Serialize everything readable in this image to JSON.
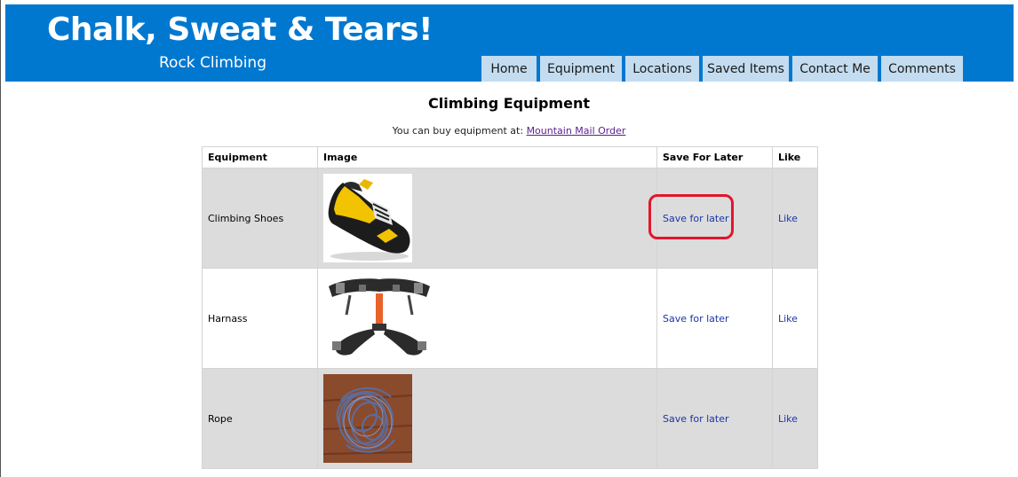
{
  "header": {
    "title": "Chalk, Sweat & Tears!",
    "subtitle": "Rock Climbing",
    "nav": [
      {
        "label": "Home"
      },
      {
        "label": "Equipment"
      },
      {
        "label": "Locations"
      },
      {
        "label": "Saved Items"
      },
      {
        "label": "Contact Me"
      },
      {
        "label": "Comments"
      }
    ]
  },
  "main": {
    "heading": "Climbing Equipment",
    "buy_text": "You can buy equipment at: ",
    "buy_link": "Mountain Mail Order",
    "columns": [
      "Equipment",
      "Image",
      "Save For Later",
      "Like"
    ],
    "rows": [
      {
        "name": "Climbing Shoes",
        "image": "climbing-shoe-image",
        "save": "Save for later",
        "like": "Like"
      },
      {
        "name": "Harnass",
        "image": "harness-image",
        "save": "Save for later",
        "like": "Like"
      },
      {
        "name": "Rope",
        "image": "rope-image",
        "save": "Save for later",
        "like": "Like"
      }
    ]
  },
  "colors": {
    "header_bg": "#0078d0",
    "nav_tab_bg": "#c3dcf0",
    "link": "#1a35a8",
    "visited_link": "#5a1f8c",
    "row_shade": "#dcdcdc",
    "highlight": "#e0182d"
  }
}
